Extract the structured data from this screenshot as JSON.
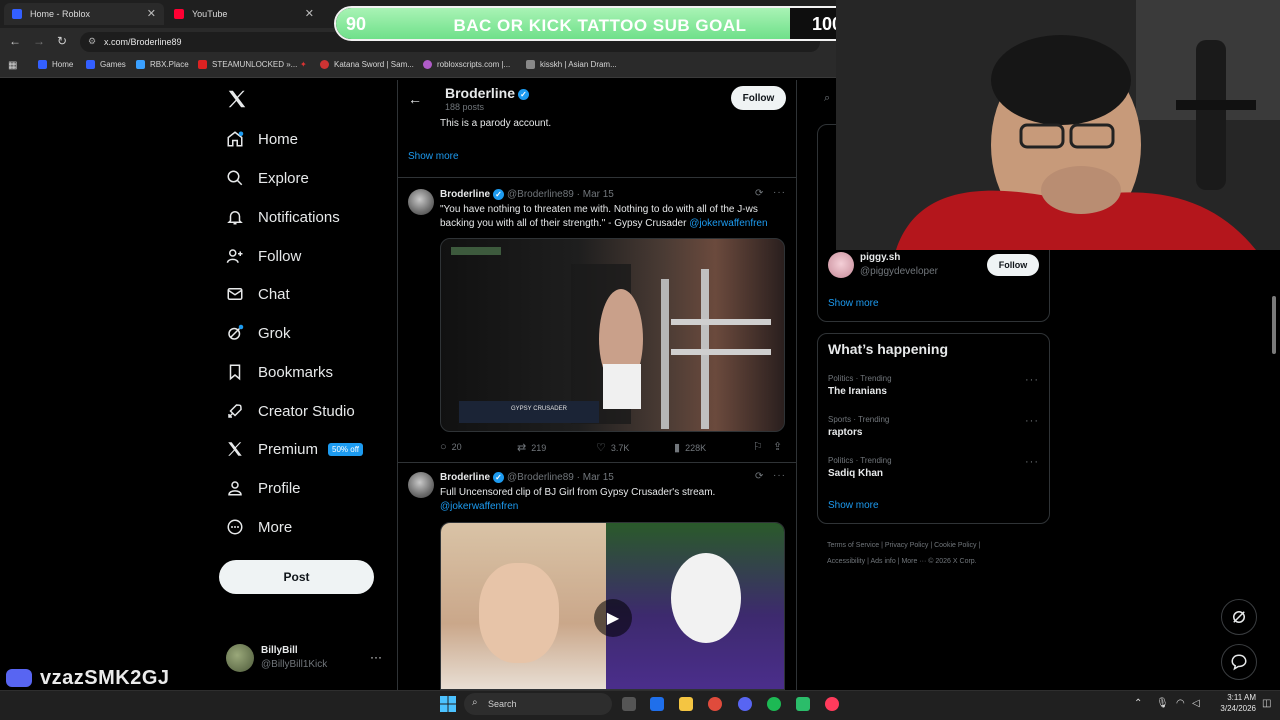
{
  "browser": {
    "tabs": [
      {
        "label": "Home - Roblox",
        "color": "#335fff"
      },
      {
        "label": "YouTube",
        "color": "#ff0033"
      }
    ],
    "url": "x.com/Broderline89",
    "bookmarks": [
      {
        "label": "Home",
        "color": "#335fff"
      },
      {
        "label": "Games",
        "color": "#335fff"
      },
      {
        "label": "RBX.Place",
        "color": "#3aa0ff"
      },
      {
        "label": "STEAMUNLOCKED »...",
        "color": "#d22"
      },
      {
        "label": "Katana Sword | Sam...",
        "color": "#c33"
      },
      {
        "label": "robloxscripts.com |...",
        "color": "#b05cc8"
      },
      {
        "label": "kisskh | Asian Dram...",
        "color": "#888"
      }
    ]
  },
  "overlay": {
    "goal_left": "90",
    "goal_title": "BAC OR KICK TATTOO SUB GOAL",
    "goal_right": "100",
    "goal_progress": 0.88,
    "watermark": "vzazSMK2GJ"
  },
  "nav": {
    "items": [
      {
        "label": "Home",
        "icon": "home-icon"
      },
      {
        "label": "Explore",
        "icon": "search-icon"
      },
      {
        "label": "Notifications",
        "icon": "bell-icon"
      },
      {
        "label": "Follow",
        "icon": "person-add-icon"
      },
      {
        "label": "Chat",
        "icon": "mail-icon"
      },
      {
        "label": "Grok",
        "icon": "grok-icon"
      },
      {
        "label": "Bookmarks",
        "icon": "bookmark-icon"
      },
      {
        "label": "Creator Studio",
        "icon": "rocket-icon"
      },
      {
        "label": "Premium",
        "icon": "x-icon"
      },
      {
        "label": "Profile",
        "icon": "person-icon"
      },
      {
        "label": "More",
        "icon": "more-circle-icon"
      }
    ],
    "premium_badge": "50% off",
    "post_label": "Post",
    "account": {
      "name": "BillyBill",
      "handle": "@BillyBill1Kick"
    }
  },
  "profile": {
    "name": "Broderline",
    "post_count": "188 posts",
    "follow_label": "Follow",
    "bio": "This is a parody account.",
    "show_more": "Show more"
  },
  "tweets": [
    {
      "name": "Broderline",
      "handle": "@Broderline89 · Mar 15",
      "text": "\"You have nothing to threaten me with. Nothing to do with all of the J-ws backing you with all of their strength.\" - Gypsy Crusader ",
      "link": "@jokerwaffenfren",
      "replies": "20",
      "reposts": "219",
      "likes": "3.7K",
      "views": "228K",
      "media_caption": "GYPSY CRUSADER"
    },
    {
      "name": "Broderline",
      "handle": "@Broderline89 · Mar 15",
      "text": "Full Uncensored clip of BJ Girl from Gypsy Crusader's stream.",
      "link": "@jokerwaffenfren"
    }
  ],
  "sidebar": {
    "suggest": {
      "name": "piggy.sh",
      "handle": "@piggydeveloper",
      "follow_label": "Follow"
    },
    "show_more": "Show more",
    "whats_happening": "What’s happening",
    "trends": [
      {
        "category": "Politics · Trending",
        "name": "The Iranians"
      },
      {
        "category": "Sports · Trending",
        "name": "raptors"
      },
      {
        "category": "Politics · Trending",
        "name": "Sadiq Khan"
      }
    ],
    "show_more_2": "Show more",
    "footer_line1": "Terms of Service  |  Privacy Policy  |  Cookie Policy  |",
    "footer_line2": "Accessibility  |  Ads info  |  More ···  © 2026 X Corp."
  },
  "taskbar": {
    "search_placeholder": "Search",
    "time": "3:11 AM",
    "date": "3/24/2026"
  }
}
